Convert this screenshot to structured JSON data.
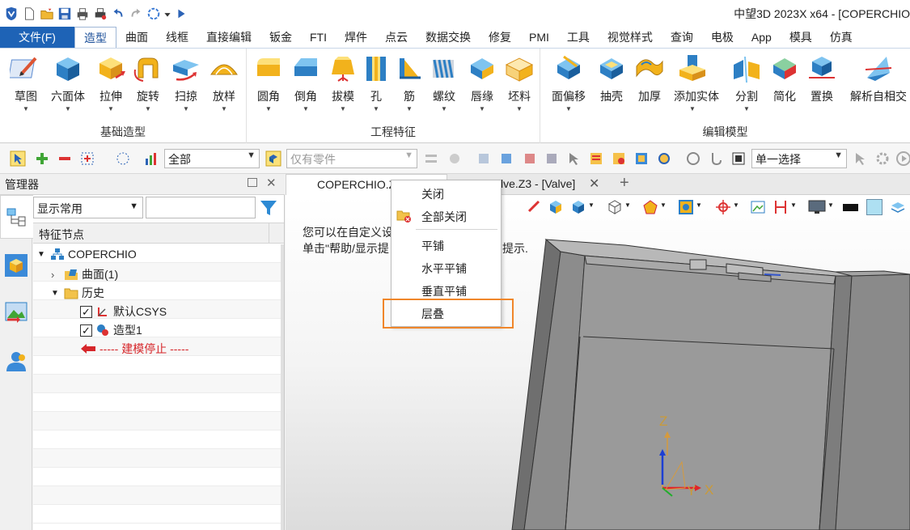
{
  "app": {
    "title": "中望3D 2023X x64 - [COPERCHIO"
  },
  "quick_access": {
    "icons": [
      "app-logo-icon",
      "new-file-icon",
      "open-file-icon",
      "save-icon",
      "print-icon",
      "print-setup-icon",
      "undo-icon",
      "redo-icon",
      "regen-icon",
      "more-icon",
      "run-icon"
    ]
  },
  "menu": {
    "file": "文件(F)",
    "tabs": [
      "造型",
      "曲面",
      "线框",
      "直接编辑",
      "钣金",
      "FTI",
      "焊件",
      "点云",
      "数据交换",
      "修复",
      "PMI",
      "工具",
      "视觉样式",
      "查询",
      "电极",
      "App",
      "模具",
      "仿真"
    ],
    "active_tab": "造型"
  },
  "ribbon": {
    "groups": [
      {
        "title": "基础造型",
        "buttons": [
          "草图",
          "六面体",
          "拉伸",
          "旋转",
          "扫掠",
          "放样"
        ]
      },
      {
        "title": "工程特征",
        "buttons": [
          "圆角",
          "倒角",
          "拔模",
          "孔",
          "筋",
          "螺纹",
          "唇缘",
          "坯料"
        ]
      },
      {
        "title": "编辑模型",
        "buttons": [
          "面偏移",
          "抽壳",
          "加厚",
          "添加实体",
          "分割",
          "简化",
          "置换",
          "解析自相交"
        ]
      }
    ]
  },
  "toolbar": {
    "filter_value": "全部",
    "part_filter_placeholder": "仅有零件",
    "select_mode": "单一选择"
  },
  "manager": {
    "title": "管理器",
    "display_select": "显示常用",
    "search_value": "",
    "column_header": "特征节点",
    "tree": {
      "root": "COPERCHIO",
      "surface": "曲面(1)",
      "history": "历史",
      "csys": "默认CSYS",
      "shape": "造型1",
      "stop": "----- 建模停止 -----"
    }
  },
  "documents": {
    "tab1": "COPERCHIO.Z3PRT",
    "tab2": "Valve.Z3 - [Valve]",
    "tab2_visible": "lve.Z3 - [Valve]"
  },
  "viewport": {
    "hint_line1": "您可以在自定义设",
    "hint_line2": "单击\"帮助/显示提",
    "hint_suffix": "提示.",
    "axis_z": "Z",
    "axis_y": "Y",
    "axis_x": "X"
  },
  "context_menu": {
    "items": [
      "关闭",
      "全部关闭",
      "平铺",
      "水平平铺",
      "垂直平铺",
      "层叠"
    ],
    "highlighted": "层叠"
  },
  "colors": {
    "file_tab": "#1e63b6",
    "highlight_border": "#f0862a",
    "model_gray": "#8a8a8a"
  }
}
